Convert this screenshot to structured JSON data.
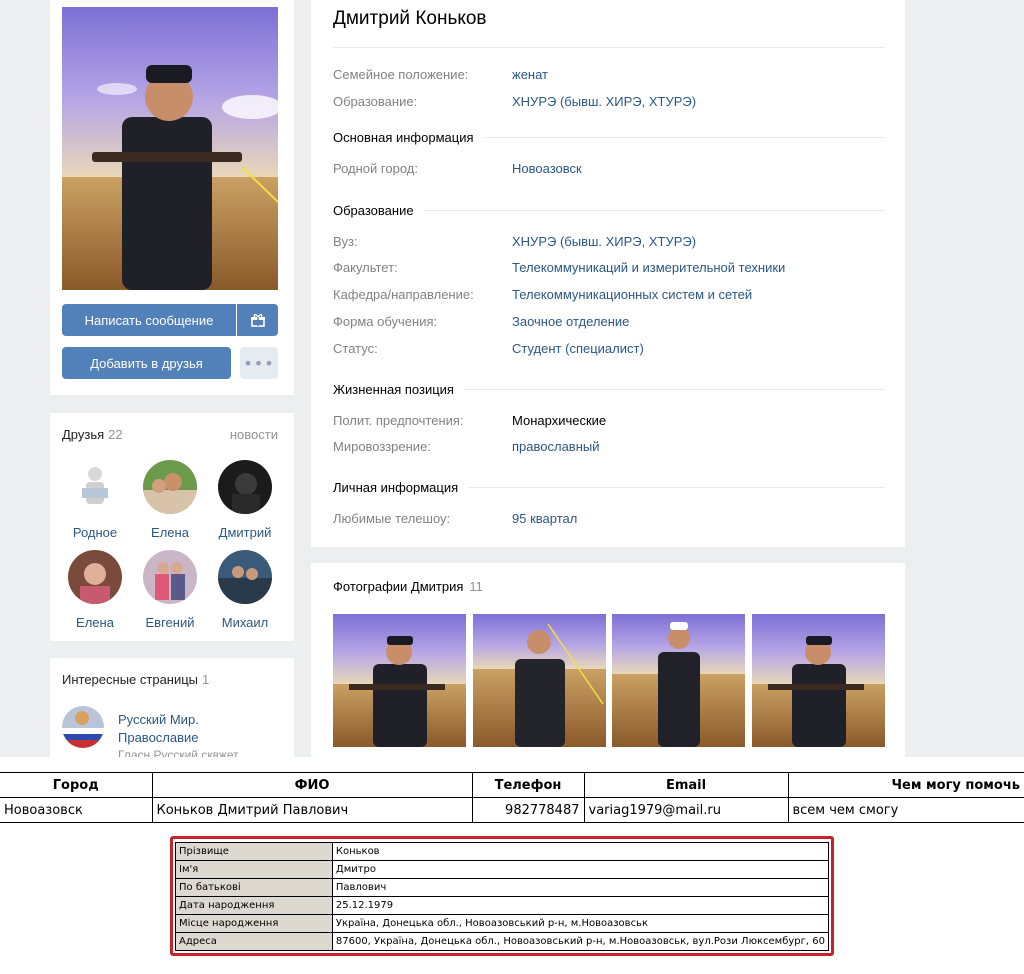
{
  "profile": {
    "name": "Дмитрий Коньков",
    "top_fields": [
      {
        "label": "Семейное положение:",
        "value": "женат"
      },
      {
        "label": "Образование:",
        "value": "ХНУРЭ (бывш. ХИРЭ, ХТУРЭ)"
      }
    ],
    "sections": [
      {
        "title": "Основная информация",
        "fields": [
          {
            "label": "Родной город:",
            "value": "Новоазовск"
          }
        ]
      },
      {
        "title": "Образование",
        "fields": [
          {
            "label": "Вуз:",
            "value": "ХНУРЭ (бывш. ХИРЭ, ХТУРЭ)"
          },
          {
            "label": "Факультет:",
            "value": "Телекоммуникаций и измерительной техники"
          },
          {
            "label": "Кафедра/направление:",
            "value": "Телекоммуникационных систем и сетей"
          },
          {
            "label": "Форма обучения:",
            "value": "Заочное отделение"
          },
          {
            "label": "Статус:",
            "value": "Студент (специалист)"
          }
        ]
      },
      {
        "title": "Жизненная позиция",
        "fields": [
          {
            "label": "Полит. предпочтения:",
            "value": "Монархические"
          },
          {
            "label": "Мировоззрение:",
            "value": "православный"
          }
        ]
      },
      {
        "title": "Личная информация",
        "fields": [
          {
            "label": "Любимые телешоу:",
            "value": "95 квартал"
          }
        ]
      }
    ]
  },
  "actions": {
    "message_label": "Написать сообщение",
    "add_friend_label": "Добавить в друзья",
    "more_label": "•••",
    "gift_icon": "gift-icon"
  },
  "friends": {
    "title": "Друзья",
    "count": "22",
    "news_link": "новости",
    "items": [
      {
        "name": "Родное"
      },
      {
        "name": "Елена"
      },
      {
        "name": "Дмитрий"
      },
      {
        "name": "Елена"
      },
      {
        "name": "Евгений"
      },
      {
        "name": "Михаил"
      }
    ]
  },
  "pages": {
    "title": "Интересные страницы",
    "count": "1",
    "item_name": "Русский Мир. Православие",
    "item_sub": "Гласн Русский сквжет"
  },
  "photos": {
    "title": "Фотографии Дмитрия",
    "count": "11"
  },
  "table1": {
    "headers": [
      "Город",
      "ФИО",
      "Телефон",
      "Email",
      "Чем могу помочь"
    ],
    "row": [
      "Новоазовск",
      "Коньков Дмитрий Павлович",
      "982778487",
      "variag1979@mail.ru",
      "всем чем смогу"
    ]
  },
  "table2": [
    {
      "key": "Прізвище",
      "value": "Коньков"
    },
    {
      "key": "Ім'я",
      "value": "Дмитро"
    },
    {
      "key": "По батькові",
      "value": "Павлович"
    },
    {
      "key": "Дата народження",
      "value": "25.12.1979"
    },
    {
      "key": "Місце народження",
      "value": "Україна, Донецька обл., Новоазовський р-н, м.Новоазовськ"
    },
    {
      "key": "Адреса",
      "value": "87600, Україна, Донецька обл., Новоазовський р-н, м.Новоазовськ, вул.Рози Люксембург, 60"
    }
  ],
  "colors": {
    "accent": "#5181b8",
    "link": "#2a5885",
    "frame": "#c8232b"
  }
}
